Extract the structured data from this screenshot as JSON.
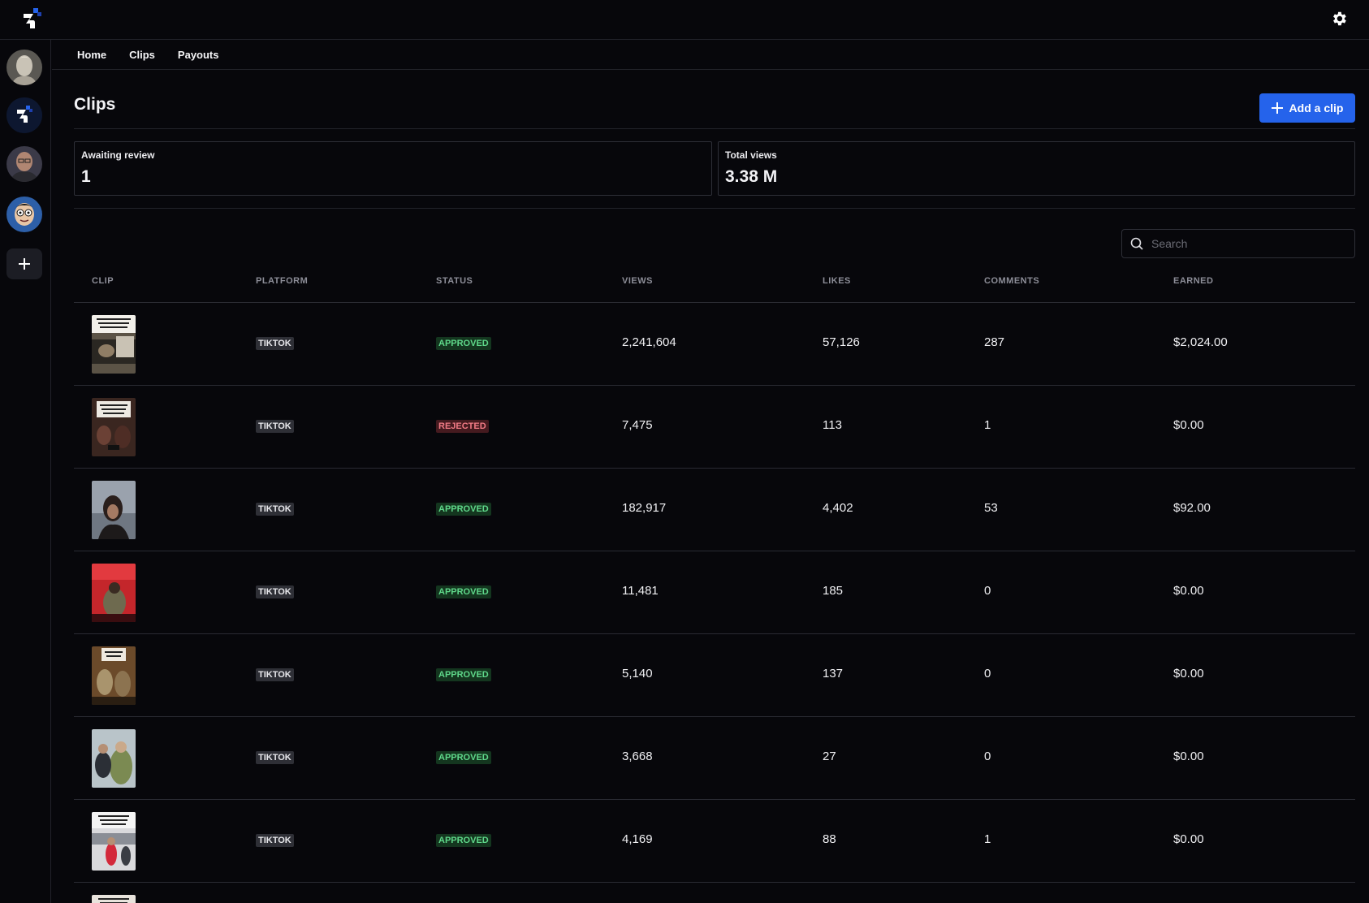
{
  "nav": {
    "home": "Home",
    "clips": "Clips",
    "payouts": "Payouts"
  },
  "page": {
    "title": "Clips",
    "add_clip_label": "Add a clip"
  },
  "stats": [
    {
      "label": "Awaiting review",
      "value": "1"
    },
    {
      "label": "Total views",
      "value": "3.38 M"
    }
  ],
  "search": {
    "placeholder": "Search"
  },
  "table": {
    "headers": [
      "CLIP",
      "PLATFORM",
      "STATUS",
      "VIEWS",
      "LIKES",
      "COMMENTS",
      "EARNED"
    ],
    "rows": [
      {
        "platform": "TIKTOK",
        "status": "APPROVED",
        "views": "2,241,604",
        "likes": "57,126",
        "comments": "287",
        "earned": "$2,024.00"
      },
      {
        "platform": "TIKTOK",
        "status": "REJECTED",
        "views": "7,475",
        "likes": "113",
        "comments": "1",
        "earned": "$0.00"
      },
      {
        "platform": "TIKTOK",
        "status": "APPROVED",
        "views": "182,917",
        "likes": "4,402",
        "comments": "53",
        "earned": "$92.00"
      },
      {
        "platform": "TIKTOK",
        "status": "APPROVED",
        "views": "11,481",
        "likes": "185",
        "comments": "0",
        "earned": "$0.00"
      },
      {
        "platform": "TIKTOK",
        "status": "APPROVED",
        "views": "5,140",
        "likes": "137",
        "comments": "0",
        "earned": "$0.00"
      },
      {
        "platform": "TIKTOK",
        "status": "APPROVED",
        "views": "3,668",
        "likes": "27",
        "comments": "0",
        "earned": "$0.00"
      },
      {
        "platform": "TIKTOK",
        "status": "APPROVED",
        "views": "4,169",
        "likes": "88",
        "comments": "1",
        "earned": "$0.00"
      }
    ]
  },
  "icons": {
    "brand": "brand-logo-icon",
    "settings": "gear-icon",
    "add": "plus-icon",
    "search": "search-icon"
  },
  "colors": {
    "accent": "#2563eb",
    "approved": "#5fd88a",
    "rejected": "#f07a85",
    "background": "#07070b"
  }
}
